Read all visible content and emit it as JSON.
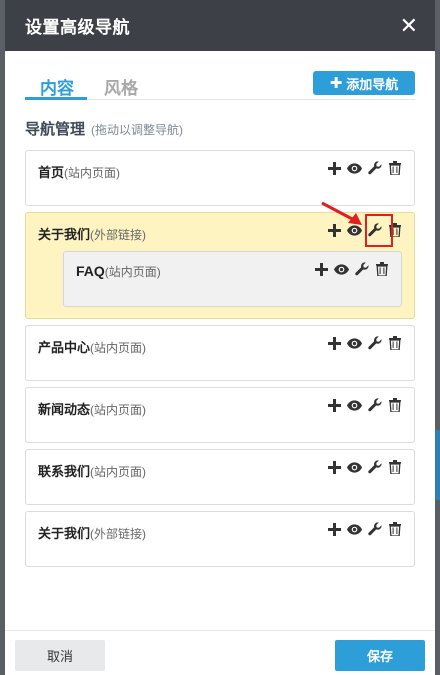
{
  "dialog": {
    "title": "设置高级导航",
    "close_icon": "close-icon"
  },
  "tabs": [
    {
      "label": "内容",
      "active": true
    },
    {
      "label": "风格",
      "active": false
    }
  ],
  "add_button": {
    "icon": "plus-icon",
    "label": "添加导航"
  },
  "section": {
    "title": "导航管理",
    "hint": "(拖动以调整导航)"
  },
  "nav_items": [
    {
      "name": "首页",
      "type": "(站内页面)"
    },
    {
      "name": "关于我们",
      "type": "(外部链接)",
      "children": [
        {
          "name": "FAQ",
          "type": "(站内页面)"
        }
      ]
    },
    {
      "name": "产品中心",
      "type": "(站内页面)"
    },
    {
      "name": "新闻动态",
      "type": "(站内页面)"
    },
    {
      "name": "联系我们",
      "type": "(站内页面)"
    },
    {
      "name": "关于我们",
      "type": "(外部链接)"
    }
  ],
  "item_actions": [
    "add-child-icon",
    "visibility-eye-icon",
    "settings-wrench-icon",
    "delete-trash-icon"
  ],
  "footer": {
    "cancel_label": "取消",
    "save_label": "保存"
  },
  "colors": {
    "accent": "#2e9ed9",
    "titlebar": "#3d4047",
    "highlight": "#fdf4c2",
    "annotation_red": "#e02020"
  }
}
